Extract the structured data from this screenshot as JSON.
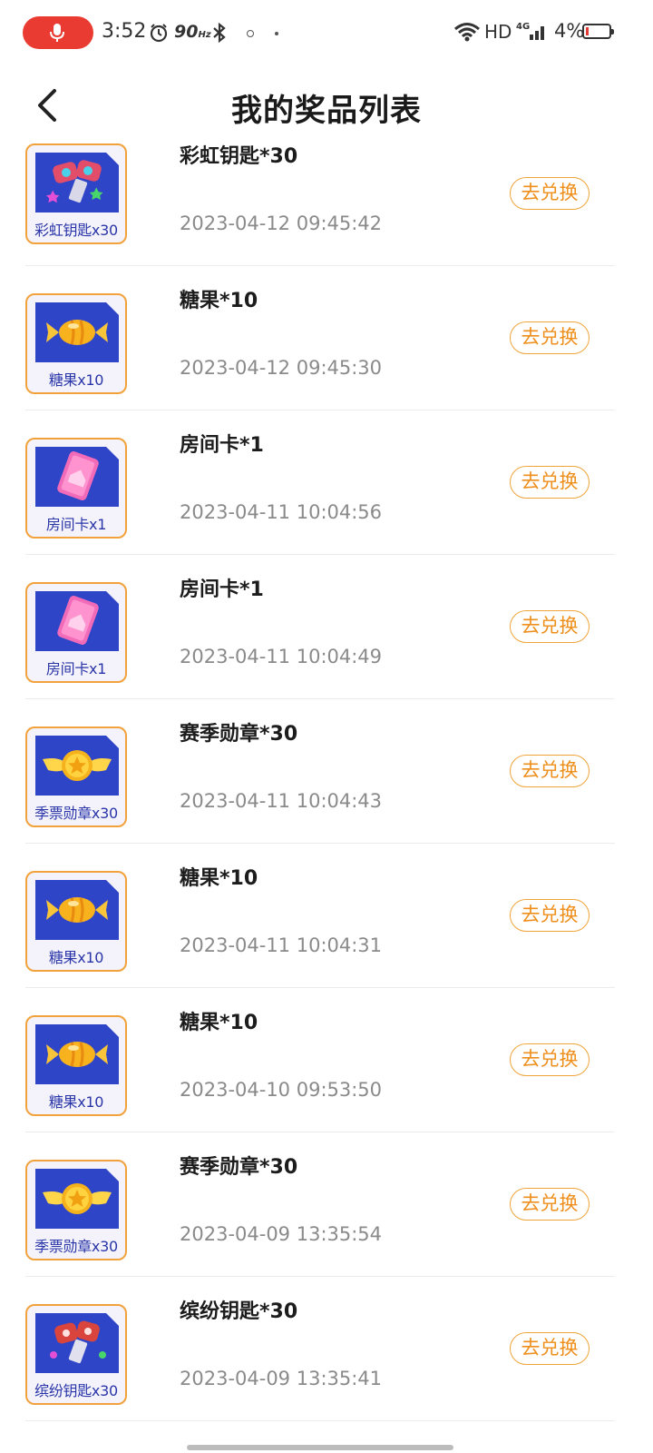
{
  "status_bar": {
    "time": "3:52",
    "refresh_rate": "90",
    "refresh_unit": "Hz",
    "network": "HD",
    "network_gen": "4G",
    "battery": "4%"
  },
  "header": {
    "title": "我的奖品列表",
    "back_icon": "chevron-left-icon"
  },
  "colors": {
    "accent": "#ee8f1c",
    "thumb_border": "#f2a23c",
    "thumb_art": "#2f45c7",
    "mic_pill": "#ea3b33"
  },
  "prizes": [
    {
      "name": "彩虹钥匙*30",
      "caption": "彩虹钥匙x30",
      "time": "2023-04-12 09:45:42",
      "button": "去兑换",
      "icon": "rainbow-key-icon"
    },
    {
      "name": "糖果*10",
      "caption": "糖果x10",
      "time": "2023-04-12 09:45:30",
      "button": "去兑换",
      "icon": "candy-icon"
    },
    {
      "name": "房间卡*1",
      "caption": "房间卡x1",
      "time": "2023-04-11 10:04:56",
      "button": "去兑换",
      "icon": "room-card-icon"
    },
    {
      "name": "房间卡*1",
      "caption": "房间卡x1",
      "time": "2023-04-11 10:04:49",
      "button": "去兑换",
      "icon": "room-card-icon"
    },
    {
      "name": "赛季勋章*30",
      "caption": "季票勋章x30",
      "time": "2023-04-11 10:04:43",
      "button": "去兑换",
      "icon": "season-medal-icon"
    },
    {
      "name": "糖果*10",
      "caption": "糖果x10",
      "time": "2023-04-11 10:04:31",
      "button": "去兑换",
      "icon": "candy-icon"
    },
    {
      "name": "糖果*10",
      "caption": "糖果x10",
      "time": "2023-04-10 09:53:50",
      "button": "去兑换",
      "icon": "candy-icon"
    },
    {
      "name": "赛季勋章*30",
      "caption": "季票勋章x30",
      "time": "2023-04-09 13:35:54",
      "button": "去兑换",
      "icon": "season-medal-icon"
    },
    {
      "name": "缤纷钥匙*30",
      "caption": "缤纷钥匙x30",
      "time": "2023-04-09 13:35:41",
      "button": "去兑换",
      "icon": "colorful-key-icon"
    }
  ]
}
